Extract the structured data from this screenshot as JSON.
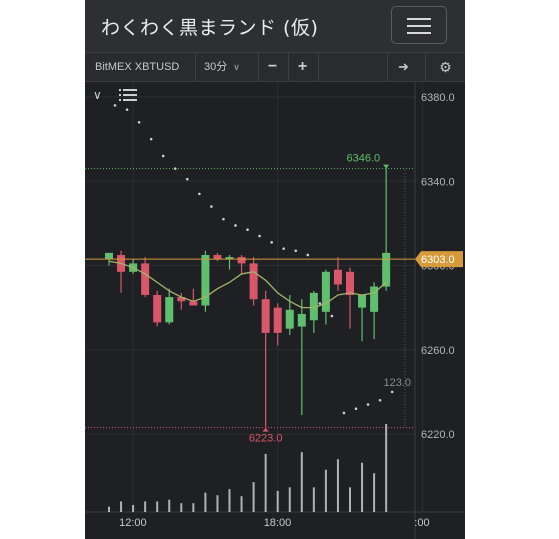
{
  "app": {
    "title": "わくわく黒まランド (仮)",
    "menu_icon": "hamburger-icon"
  },
  "toolbar": {
    "symbol": "BitMEX XBTUSD",
    "interval": "30分",
    "zoom_out": "−",
    "zoom_in": "+",
    "forward": "➜",
    "settings": "⚙"
  },
  "chart_controls": {
    "collapse_icon": "chevron-down-icon",
    "indicators_icon": "list-icon"
  },
  "colors": {
    "background": "#1f2023",
    "up": "#5fbf6e",
    "down": "#d9566b",
    "current_price": "#d59a3a",
    "ma": "#a5b36a",
    "sar": "#cfcfcf",
    "volume": "#cccccc",
    "grid": "#2c2e32"
  },
  "chart_data": {
    "type": "candlestick",
    "ylim": [
      6205,
      6390
    ],
    "y_ticks": [
      "6380.0",
      "6340.0",
      "6300.0",
      "6260.0",
      "6220.0"
    ],
    "x_ticks": [
      {
        "index": 2,
        "label": "12:00"
      },
      {
        "index": 14,
        "label": "18:00"
      },
      {
        "index": 26,
        "label": ":00"
      }
    ],
    "current_price": "6303.0",
    "high_marker": "6346.0",
    "low_marker": "6223.0",
    "volume_label": "123.0",
    "candles": [
      {
        "o": 6303,
        "h": 6306,
        "l": 6300,
        "c": 6306
      },
      {
        "o": 6305,
        "h": 6307,
        "l": 6287,
        "c": 6297
      },
      {
        "o": 6297,
        "h": 6303,
        "l": 6296,
        "c": 6301
      },
      {
        "o": 6301,
        "h": 6304,
        "l": 6285,
        "c": 6286
      },
      {
        "o": 6286,
        "h": 6288,
        "l": 6271,
        "c": 6273
      },
      {
        "o": 6273,
        "h": 6289,
        "l": 6272,
        "c": 6285
      },
      {
        "o": 6285,
        "h": 6287,
        "l": 6279,
        "c": 6283
      },
      {
        "o": 6283,
        "h": 6289,
        "l": 6281,
        "c": 6281
      },
      {
        "o": 6281,
        "h": 6307,
        "l": 6278,
        "c": 6305
      },
      {
        "o": 6305,
        "h": 6306,
        "l": 6302,
        "c": 6303
      },
      {
        "o": 6303,
        "h": 6305,
        "l": 6298,
        "c": 6304
      },
      {
        "o": 6304,
        "h": 6305,
        "l": 6296,
        "c": 6301
      },
      {
        "o": 6301,
        "h": 6304,
        "l": 6281,
        "c": 6284
      },
      {
        "o": 6284,
        "h": 6288,
        "l": 6223,
        "c": 6268
      },
      {
        "o": 6280,
        "h": 6282,
        "l": 6262,
        "c": 6268
      },
      {
        "o": 6270,
        "h": 6286,
        "l": 6267,
        "c": 6279
      },
      {
        "o": 6271,
        "h": 6284,
        "l": 6229,
        "c": 6277
      },
      {
        "o": 6274,
        "h": 6288,
        "l": 6268,
        "c": 6287
      },
      {
        "o": 6278,
        "h": 6298,
        "l": 6272,
        "c": 6297
      },
      {
        "o": 6298,
        "h": 6304,
        "l": 6288,
        "c": 6291
      },
      {
        "o": 6297,
        "h": 6299,
        "l": 6270,
        "c": 6286
      },
      {
        "o": 6280,
        "h": 6286,
        "l": 6264,
        "c": 6286
      },
      {
        "o": 6278,
        "h": 6292,
        "l": 6265,
        "c": 6290
      },
      {
        "o": 6290,
        "h": 6346,
        "l": 6288,
        "c": 6306
      }
    ],
    "ma": [
      6302,
      6301,
      6299,
      6296,
      6292,
      6288,
      6285,
      6283,
      6285,
      6289,
      6292,
      6296,
      6297,
      6293,
      6287,
      6283,
      6280,
      6280,
      6282,
      6286,
      6287,
      6286,
      6287,
      6292
    ],
    "sar": [
      6376,
      6374,
      6368,
      6360,
      6352,
      6346,
      6341,
      6334,
      6328,
      6322,
      6319,
      6317,
      6314,
      6311,
      6308,
      6307,
      6305,
      6282,
      6276,
      6230,
      6232,
      6234,
      6236,
      6240
    ],
    "volume": [
      6,
      12,
      8,
      12,
      12,
      14,
      10,
      10,
      22,
      19,
      26,
      18,
      34,
      66,
      24,
      28,
      68,
      28,
      48,
      60,
      28,
      56,
      44,
      100
    ]
  }
}
